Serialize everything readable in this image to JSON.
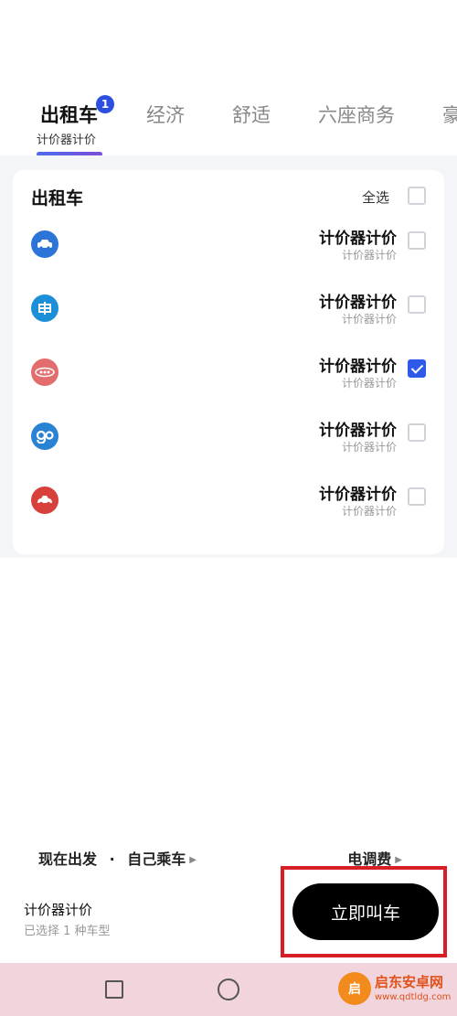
{
  "tabs": [
    {
      "label": "出租车",
      "badge": "1",
      "sub": "计价器计价",
      "active": true
    },
    {
      "label": "经济"
    },
    {
      "label": "舒适"
    },
    {
      "label": "六座商务"
    },
    {
      "label": "豪"
    }
  ],
  "card": {
    "title": "出租车",
    "select_all_label": "全选",
    "rows": [
      {
        "icon": "car-icon",
        "icon_color": "#2d74d8",
        "price": "计价器计价",
        "sub": "计价器计价",
        "checked": false
      },
      {
        "icon": "shen-taxi-icon",
        "icon_color": "#1d8fd8",
        "price": "计价器计价",
        "sub": "计价器计价",
        "checked": false
      },
      {
        "icon": "taxi-logo-icon",
        "icon_color": "#e36d6d",
        "price": "计价器计价",
        "sub": "计价器计价",
        "checked": true
      },
      {
        "icon": "go-icon",
        "icon_color": "#2a82d4",
        "price": "计价器计价",
        "sub": "计价器计价",
        "checked": false
      },
      {
        "icon": "red-car-icon",
        "icon_color": "#d8403c",
        "price": "计价器计价",
        "sub": "计价器计价",
        "checked": false
      }
    ]
  },
  "bottom": {
    "depart_label": "现在出发",
    "separator": "·",
    "rider_label": "自己乘车",
    "fee_label": "电调费",
    "summary_price": "计价器计价",
    "summary_sub": "已选择 1 种车型",
    "cta_label": "立即叫车"
  },
  "watermark": {
    "title": "启东安卓网",
    "url": "www.qdtldg.com"
  },
  "colors": {
    "accent": "#2d5ae8",
    "cta_bg": "#000000",
    "highlight_frame": "#d91f26",
    "navbar_bg": "#f1d4dc"
  }
}
